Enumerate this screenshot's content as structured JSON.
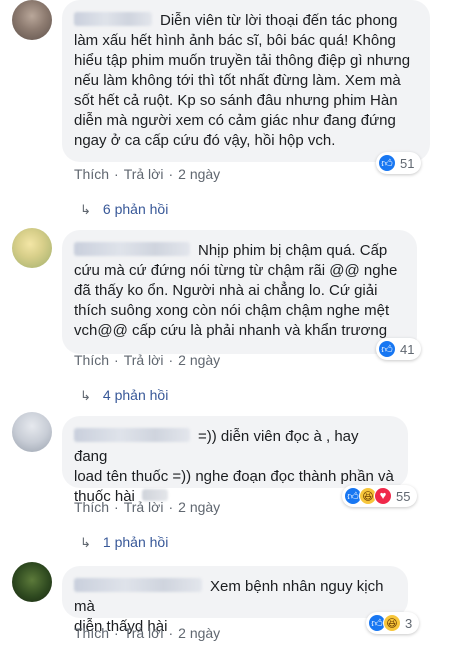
{
  "comments": [
    {
      "text_lines": [
        "Diễn viên từ lời thoại đến tác phong",
        "làm xấu hết hình ảnh bác sĩ, bôi bác quá! Không",
        "hiểu tập phim muốn truyền tải thông điệp gì nhưng",
        "nếu làm không tới thì tốt nhất đừng làm. Xem mà",
        "sốt hết cả ruột. Kp so sánh đâu nhưng phim Hàn",
        "diễn mà người xem có cảm giác như đang đứng",
        "ngay ở ca cấp cứu đó vậy, hồi hộp vch."
      ],
      "like_label": "Thích",
      "reply_label": "Trả lời",
      "time": "2 ngày",
      "reaction_count": "51",
      "replies_label": "6 phản hồi"
    },
    {
      "text_lines": [
        "Nhịp phim bị chậm quá. Cấp",
        "cứu mà cứ đứng nói từng từ chậm rãi @@ nghe",
        "đã thấy ko ổn. Người nhà ai chẳng lo. Cứ giải",
        "thích suông xong còn nói chậm chậm nghe mệt",
        "vch@@ cấp cứu là phải nhanh và khẩn trương"
      ],
      "like_label": "Thích",
      "reply_label": "Trả lời",
      "time": "2 ngày",
      "reaction_count": "41",
      "replies_label": "4 phản hồi"
    },
    {
      "text_lines": [
        "=)) diễn viên đọc à , hay đang",
        "load tên thuốc =)) nghe đoạn đọc thành phần và",
        "thuốc hài"
      ],
      "like_label": "Thích",
      "reply_label": "Trả lời",
      "time": "2 ngày",
      "reaction_count": "55",
      "replies_label": "1 phản hồi"
    },
    {
      "text_lines": [
        "Xem bệnh nhân nguy kịch mà",
        "diễn thấyd hài"
      ],
      "like_label": "Thích",
      "reply_label": "Trả lời",
      "time": "2 ngày",
      "reaction_count": "3"
    }
  ],
  "icons": {
    "like": "thumbs-up-icon",
    "haha": "laughing-face-icon",
    "love": "heart-icon",
    "reply_arrow": "reply-arrow-icon"
  },
  "colors": {
    "link": "#385898",
    "meta": "#606770",
    "bubble": "#f2f3f5",
    "like": "#1877f2",
    "haha": "#f7c63b",
    "love": "#f0284a"
  }
}
